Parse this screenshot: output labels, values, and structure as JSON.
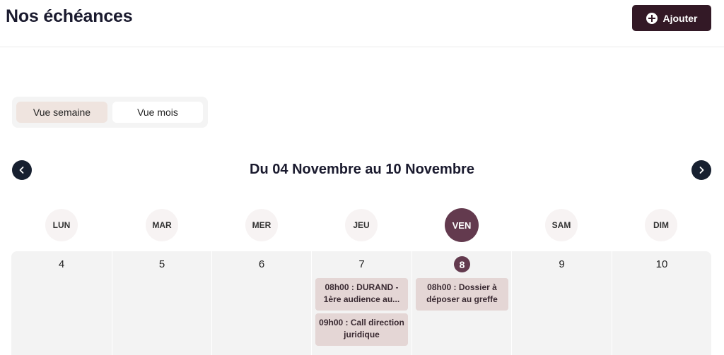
{
  "header": {
    "title": "Nos échéances",
    "add_label": "Ajouter"
  },
  "view_toggle": {
    "week_label": "Vue semaine",
    "month_label": "Vue mois",
    "selected": "week"
  },
  "week_nav": {
    "range_label": "Du 04 Novembre au 10 Novembre"
  },
  "days": [
    {
      "abbr": "LUN",
      "num": "4"
    },
    {
      "abbr": "MAR",
      "num": "5"
    },
    {
      "abbr": "MER",
      "num": "6"
    },
    {
      "abbr": "JEU",
      "num": "7"
    },
    {
      "abbr": "VEN",
      "num": "8"
    },
    {
      "abbr": "SAM",
      "num": "9"
    },
    {
      "abbr": "DIM",
      "num": "10"
    }
  ],
  "today_index": 4,
  "events": {
    "thu": [
      {
        "line1": "08h00 : DURAND -",
        "line2": "1ère audience au..."
      },
      {
        "line1": "09h00 : Call direction",
        "line2": "juridique"
      }
    ],
    "fri": [
      {
        "line1": "08h00 : Dossier à",
        "line2": "déposer au greffe"
      }
    ]
  },
  "colors": {
    "primary": "#331926",
    "accent": "#633a4e",
    "event_bg": "#e4d6d5"
  }
}
